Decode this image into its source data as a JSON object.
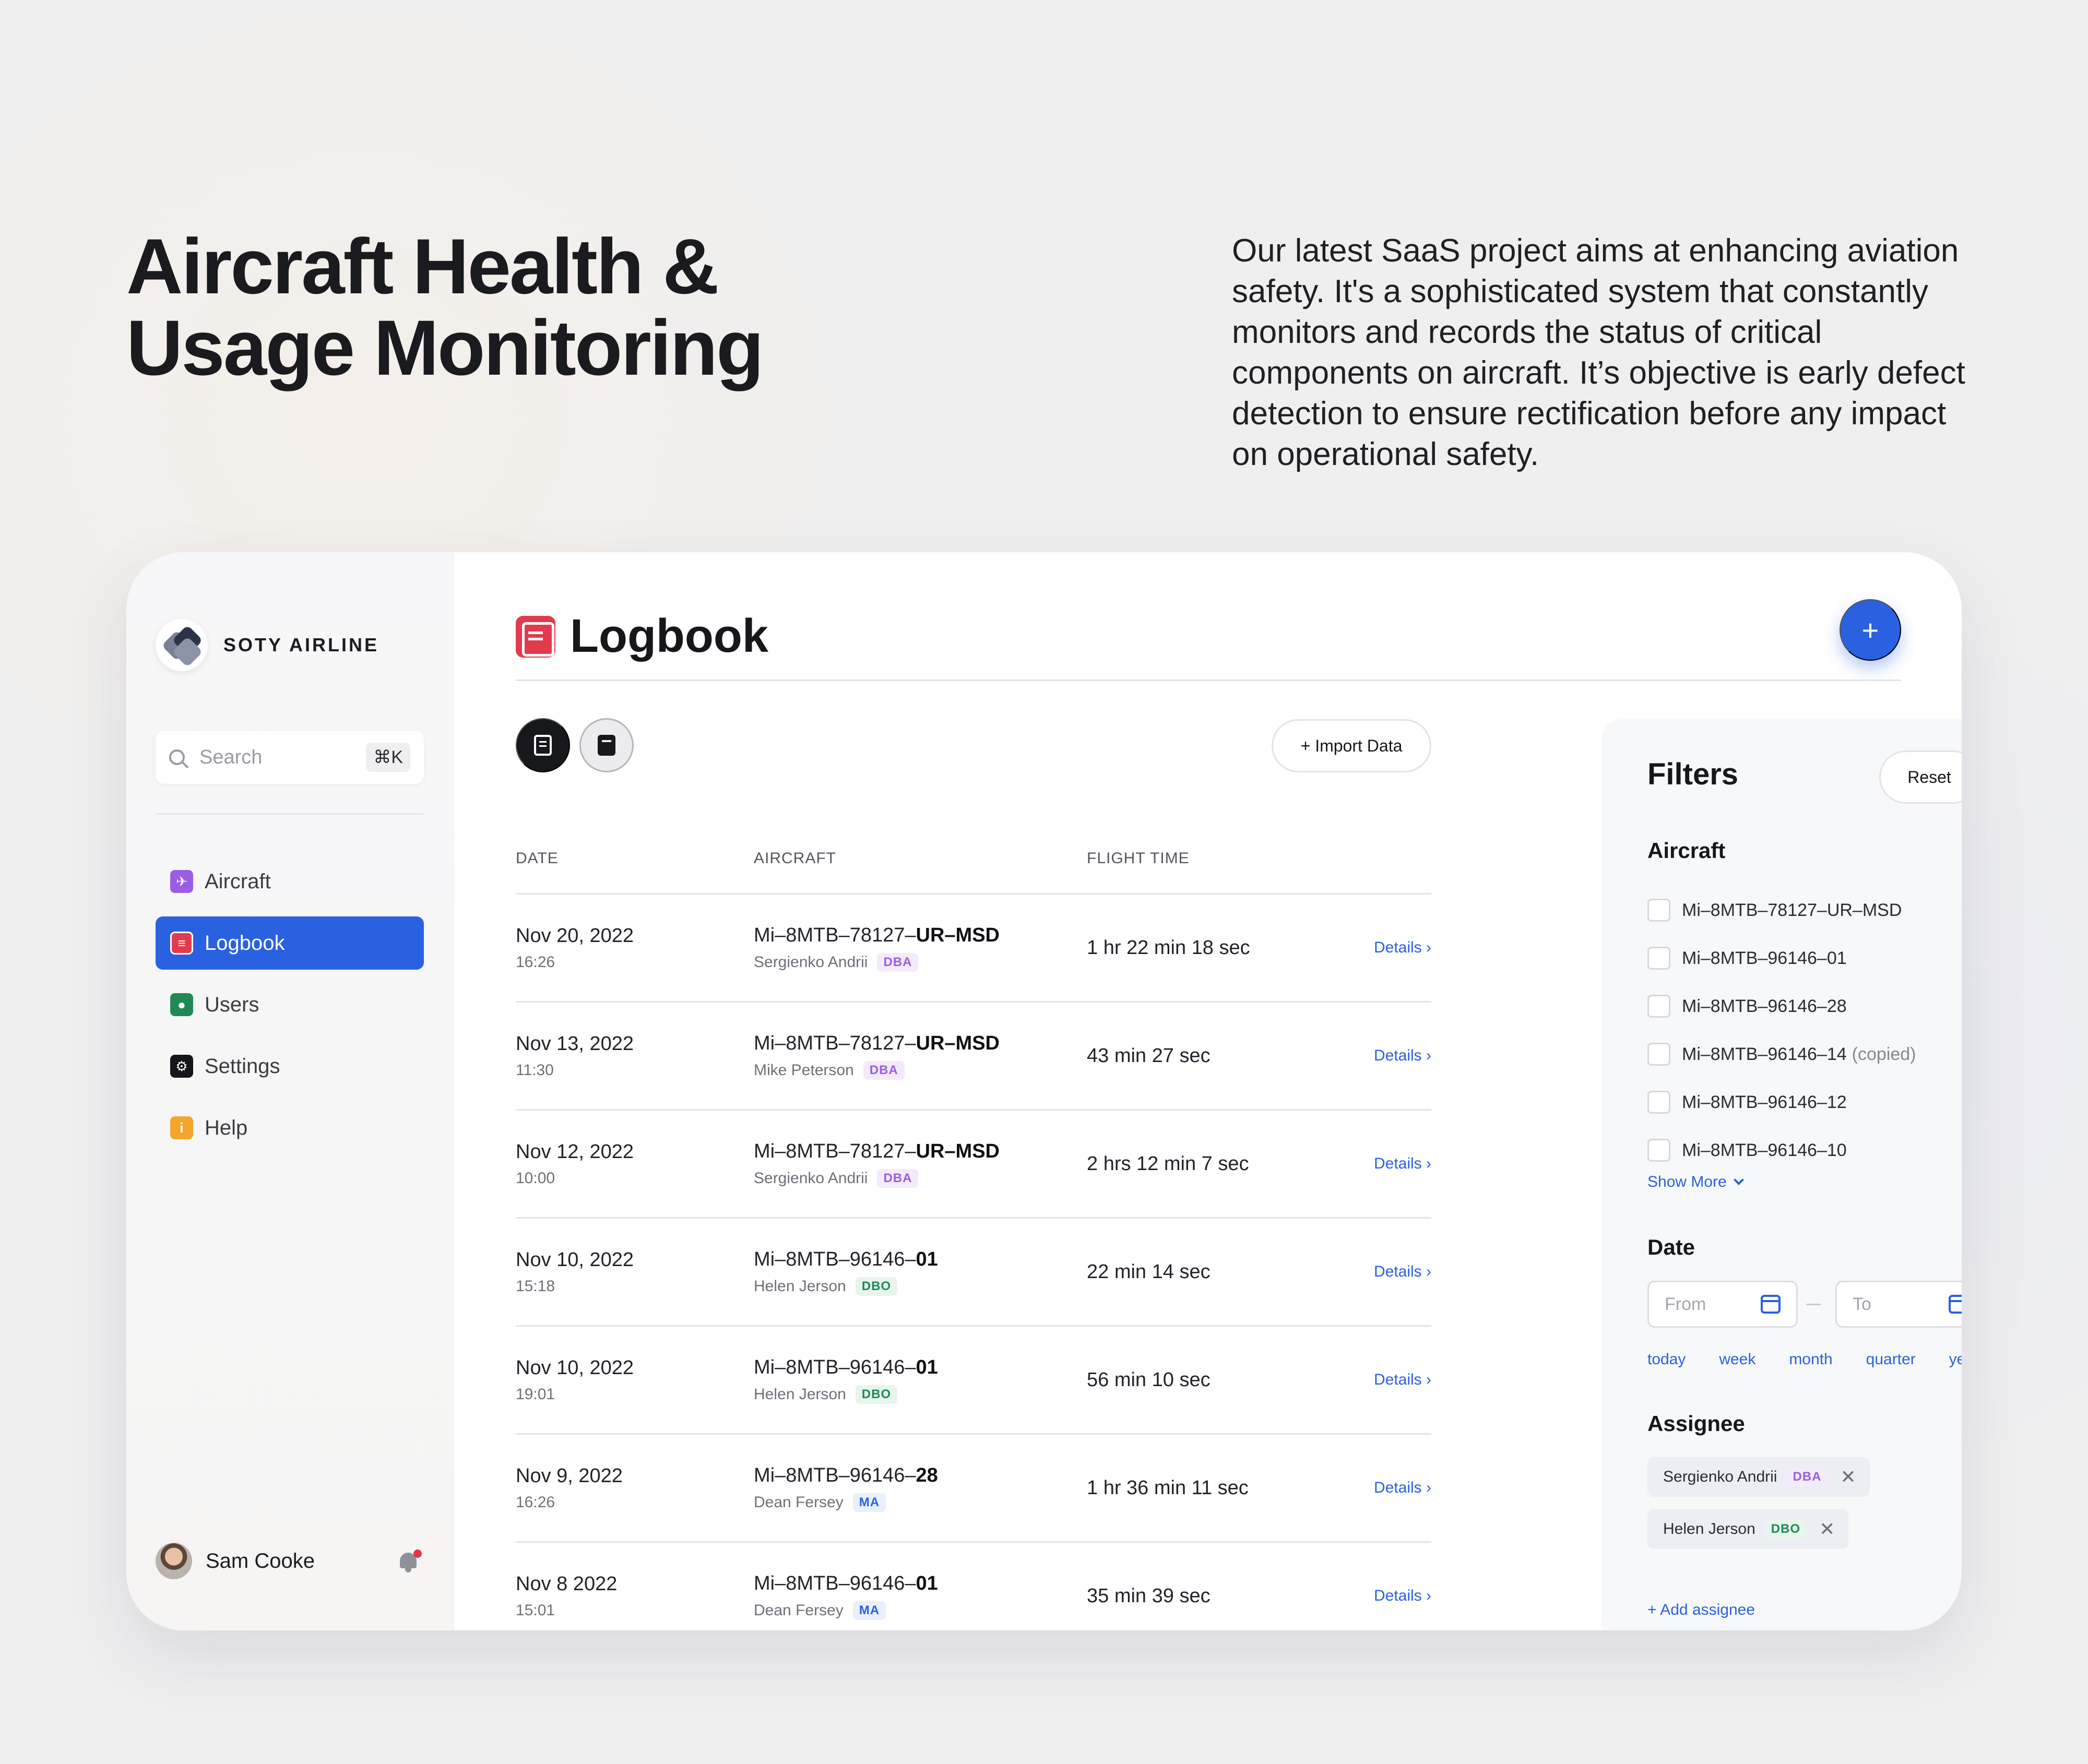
{
  "hero": {
    "title": "Aircraft Health & Usage Monitoring",
    "description": "Our latest SaaS project aims at enhancing aviation safety. It's a sophisticated system that constantly monitors and records the status of critical components on aircraft. It’s objective is early defect detection to ensure rectification before any impact on operational safety."
  },
  "sidebar": {
    "brand": "SOTY AIRLINE",
    "search": {
      "placeholder": "Search",
      "shortcut": "⌘K"
    },
    "items": [
      {
        "label": "Aircraft",
        "icon": "aircraft-icon",
        "active": false
      },
      {
        "label": "Logbook",
        "icon": "logbook-icon",
        "active": true
      },
      {
        "label": "Users",
        "icon": "users-icon",
        "active": false
      },
      {
        "label": "Settings",
        "icon": "settings-icon",
        "active": false
      },
      {
        "label": "Help",
        "icon": "help-icon",
        "active": false
      }
    ],
    "user": {
      "name": "Sam Cooke"
    }
  },
  "main": {
    "title": "Logbook",
    "add_label": "+",
    "import_label": "+ Import Data",
    "table": {
      "headers": {
        "date": "DATE",
        "aircraft": "AIRCRAFT",
        "flight_time": "FLIGHT TIME"
      },
      "details_label": "Details",
      "rows": [
        {
          "date": "Nov 20, 2022",
          "time": "16:26",
          "ac_prefix": "Mi–8MTB–78127–",
          "ac_bold": "UR–MSD",
          "person": "Sergienko Andrii",
          "badge": "DBA",
          "flight_time": "1 hr 22 min 18 sec"
        },
        {
          "date": "Nov 13, 2022",
          "time": "11:30",
          "ac_prefix": "Mi–8MTB–78127–",
          "ac_bold": "UR–MSD",
          "person": "Mike Peterson",
          "badge": "DBA",
          "flight_time": "43 min 27 sec"
        },
        {
          "date": "Nov 12, 2022",
          "time": "10:00",
          "ac_prefix": "Mi–8MTB–78127–",
          "ac_bold": "UR–MSD",
          "person": "Sergienko Andrii",
          "badge": "DBA",
          "flight_time": "2 hrs 12 min 7 sec"
        },
        {
          "date": "Nov 10, 2022",
          "time": "15:18",
          "ac_prefix": "Mi–8MTB–96146–",
          "ac_bold": "01",
          "person": "Helen Jerson",
          "badge": "DBO",
          "flight_time": "22 min 14 sec"
        },
        {
          "date": "Nov 10, 2022",
          "time": "19:01",
          "ac_prefix": "Mi–8MTB–96146–",
          "ac_bold": "01",
          "person": "Helen Jerson",
          "badge": "DBO",
          "flight_time": "56 min 10 sec"
        },
        {
          "date": "Nov 9, 2022",
          "time": "16:26",
          "ac_prefix": "Mi–8MTB–96146–",
          "ac_bold": "28",
          "person": "Dean Fersey",
          "badge": "MA",
          "flight_time": "1 hr 36 min 11 sec"
        },
        {
          "date": "Nov 8 2022",
          "time": "15:01",
          "ac_prefix": "Mi–8MTB–96146–",
          "ac_bold": "01",
          "person": "Dean Fersey",
          "badge": "MA",
          "flight_time": "35 min 39 sec"
        }
      ]
    }
  },
  "filters": {
    "title": "Filters",
    "reset_label": "Reset",
    "aircraft_label": "Aircraft",
    "aircraft_options": [
      {
        "label": "Mi–8MTB–78127–UR–MSD",
        "note": ""
      },
      {
        "label": "Mi–8MTB–96146–01",
        "note": ""
      },
      {
        "label": "Mi–8MTB–96146–28",
        "note": ""
      },
      {
        "label": "Mi–8MTB–96146–14",
        "note": "(copied)"
      },
      {
        "label": "Mi–8MTB–96146–12",
        "note": ""
      },
      {
        "label": "Mi–8MTB–96146–10",
        "note": ""
      }
    ],
    "show_more_label": "Show More",
    "date_label": "Date",
    "from_placeholder": "From",
    "to_placeholder": "To",
    "presets": [
      "today",
      "week",
      "month",
      "quarter",
      "year"
    ],
    "assignee_label": "Assignee",
    "assignees": [
      {
        "name": "Sergienko Andrii",
        "badge": "DBA"
      },
      {
        "name": "Helen Jerson",
        "badge": "DBO"
      }
    ],
    "add_assignee_label": "+ Add assignee"
  },
  "colors": {
    "accent": "#2a61e0",
    "logbook_red": "#e23b4e",
    "badge_dba": "#9b5de5",
    "badge_dbo": "#1f8a56",
    "badge_ma": "#2a61e0"
  }
}
